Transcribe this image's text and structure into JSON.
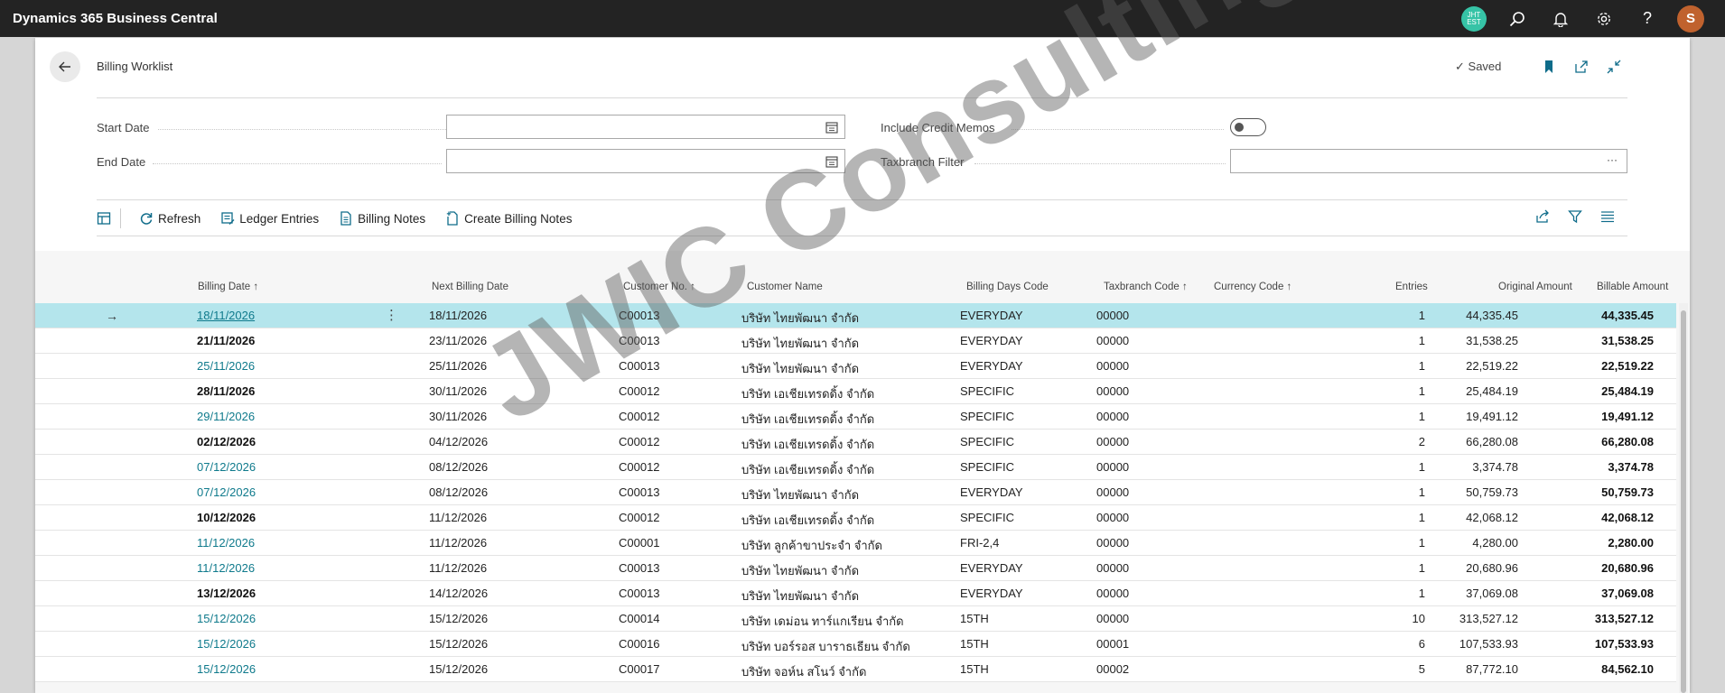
{
  "app": {
    "title": "Dynamics 365 Business Central",
    "company_badge": "JHT EST",
    "user_initial": "S"
  },
  "page": {
    "title": "Billing Worklist",
    "saved_label": "Saved"
  },
  "filters": {
    "start_date": {
      "label": "Start Date",
      "value": ""
    },
    "end_date": {
      "label": "End Date",
      "value": ""
    },
    "include_credit_memos": {
      "label": "Include Credit Memos",
      "value": false
    },
    "taxbranch_filter": {
      "label": "Taxbranch Filter",
      "value": "",
      "button": "···"
    }
  },
  "actions": {
    "refresh": "Refresh",
    "ledger_entries": "Ledger Entries",
    "billing_notes": "Billing Notes",
    "create_billing_notes": "Create Billing Notes"
  },
  "table": {
    "headers": {
      "billing_date": "Billing Date",
      "next_billing_date": "Next Billing Date",
      "customer_no": "Customer No.",
      "customer_name": "Customer Name",
      "billing_days_code": "Billing Days Code",
      "taxbranch_code": "Taxbranch Code",
      "currency_code": "Currency Code",
      "entries": "Entries",
      "original_amount": "Original Amount",
      "billable_amount": "Billable Amount"
    },
    "sort_arrow": "↑",
    "rows": [
      {
        "billing_date": "18/11/2026",
        "next_billing_date": "18/11/2026",
        "customer_no": "C00013",
        "customer_name": "บริษัท ไทยพัฒนา จำกัด",
        "billing_days_code": "EVERYDAY",
        "taxbranch_code": "00000",
        "entries": "1",
        "original_amount": "44,335.45",
        "billable_amount": "44,335.45",
        "style": "link"
      },
      {
        "billing_date": "21/11/2026",
        "next_billing_date": "23/11/2026",
        "customer_no": "C00013",
        "customer_name": "บริษัท ไทยพัฒนา จำกัด",
        "billing_days_code": "EVERYDAY",
        "taxbranch_code": "00000",
        "entries": "1",
        "original_amount": "31,538.25",
        "billable_amount": "31,538.25",
        "style": "bold"
      },
      {
        "billing_date": "25/11/2026",
        "next_billing_date": "25/11/2026",
        "customer_no": "C00013",
        "customer_name": "บริษัท ไทยพัฒนา จำกัด",
        "billing_days_code": "EVERYDAY",
        "taxbranch_code": "00000",
        "entries": "1",
        "original_amount": "22,519.22",
        "billable_amount": "22,519.22",
        "style": "link"
      },
      {
        "billing_date": "28/11/2026",
        "next_billing_date": "30/11/2026",
        "customer_no": "C00012",
        "customer_name": "บริษัท เอเชียเทรดดิ้ง จำกัด",
        "billing_days_code": "SPECIFIC",
        "taxbranch_code": "00000",
        "entries": "1",
        "original_amount": "25,484.19",
        "billable_amount": "25,484.19",
        "style": "bold"
      },
      {
        "billing_date": "29/11/2026",
        "next_billing_date": "30/11/2026",
        "customer_no": "C00012",
        "customer_name": "บริษัท เอเชียเทรดดิ้ง จำกัด",
        "billing_days_code": "SPECIFIC",
        "taxbranch_code": "00000",
        "entries": "1",
        "original_amount": "19,491.12",
        "billable_amount": "19,491.12",
        "style": "link"
      },
      {
        "billing_date": "02/12/2026",
        "next_billing_date": "04/12/2026",
        "customer_no": "C00012",
        "customer_name": "บริษัท เอเชียเทรดดิ้ง จำกัด",
        "billing_days_code": "SPECIFIC",
        "taxbranch_code": "00000",
        "entries": "2",
        "original_amount": "66,280.08",
        "billable_amount": "66,280.08",
        "style": "bold"
      },
      {
        "billing_date": "07/12/2026",
        "next_billing_date": "08/12/2026",
        "customer_no": "C00012",
        "customer_name": "บริษัท เอเชียเทรดดิ้ง จำกัด",
        "billing_days_code": "SPECIFIC",
        "taxbranch_code": "00000",
        "entries": "1",
        "original_amount": "3,374.78",
        "billable_amount": "3,374.78",
        "style": "link"
      },
      {
        "billing_date": "07/12/2026",
        "next_billing_date": "08/12/2026",
        "customer_no": "C00013",
        "customer_name": "บริษัท ไทยพัฒนา จำกัด",
        "billing_days_code": "EVERYDAY",
        "taxbranch_code": "00000",
        "entries": "1",
        "original_amount": "50,759.73",
        "billable_amount": "50,759.73",
        "style": "link"
      },
      {
        "billing_date": "10/12/2026",
        "next_billing_date": "11/12/2026",
        "customer_no": "C00012",
        "customer_name": "บริษัท เอเชียเทรดดิ้ง จำกัด",
        "billing_days_code": "SPECIFIC",
        "taxbranch_code": "00000",
        "entries": "1",
        "original_amount": "42,068.12",
        "billable_amount": "42,068.12",
        "style": "bold"
      },
      {
        "billing_date": "11/12/2026",
        "next_billing_date": "11/12/2026",
        "customer_no": "C00001",
        "customer_name": "บริษัท ลูกค้าขาประจำ จำกัด",
        "billing_days_code": "FRI-2,4",
        "taxbranch_code": "00000",
        "entries": "1",
        "original_amount": "4,280.00",
        "billable_amount": "2,280.00",
        "style": "link"
      },
      {
        "billing_date": "11/12/2026",
        "next_billing_date": "11/12/2026",
        "customer_no": "C00013",
        "customer_name": "บริษัท ไทยพัฒนา จำกัด",
        "billing_days_code": "EVERYDAY",
        "taxbranch_code": "00000",
        "entries": "1",
        "original_amount": "20,680.96",
        "billable_amount": "20,680.96",
        "style": "link"
      },
      {
        "billing_date": "13/12/2026",
        "next_billing_date": "14/12/2026",
        "customer_no": "C00013",
        "customer_name": "บริษัท ไทยพัฒนา จำกัด",
        "billing_days_code": "EVERYDAY",
        "taxbranch_code": "00000",
        "entries": "1",
        "original_amount": "37,069.08",
        "billable_amount": "37,069.08",
        "style": "bold"
      },
      {
        "billing_date": "15/12/2026",
        "next_billing_date": "15/12/2026",
        "customer_no": "C00014",
        "customer_name": "บริษัท เดม่อน ทาร์แกเรียน จำกัด",
        "billing_days_code": "15TH",
        "taxbranch_code": "00000",
        "entries": "10",
        "original_amount": "313,527.12",
        "billable_amount": "313,527.12",
        "style": "link"
      },
      {
        "billing_date": "15/12/2026",
        "next_billing_date": "15/12/2026",
        "customer_no": "C00016",
        "customer_name": "บริษัท บอร์รอส บาราธเธียน จำกัด",
        "billing_days_code": "15TH",
        "taxbranch_code": "00001",
        "entries": "6",
        "original_amount": "107,533.93",
        "billable_amount": "107,533.93",
        "style": "link"
      },
      {
        "billing_date": "15/12/2026",
        "next_billing_date": "15/12/2026",
        "customer_no": "C00017",
        "customer_name": "บริษัท จอห์น สโนว์ จำกัด",
        "billing_days_code": "15TH",
        "taxbranch_code": "00002",
        "entries": "5",
        "original_amount": "87,772.10",
        "billable_amount": "84,562.10",
        "style": "link"
      }
    ]
  },
  "watermark": "JWIC Consulting"
}
